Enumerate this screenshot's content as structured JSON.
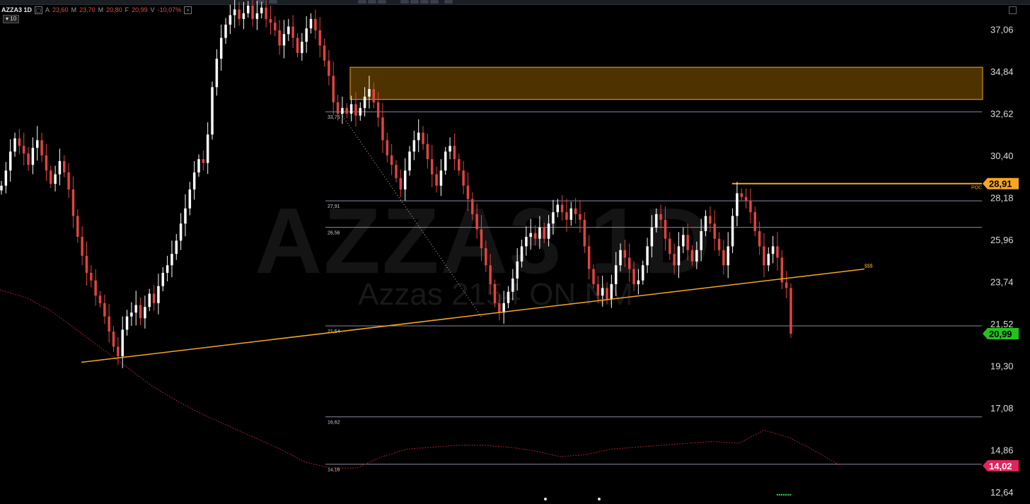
{
  "header": {
    "symbol": "AZZA3 1D",
    "open_label": "A",
    "open_value": "23,60",
    "high_label": "M",
    "high_value": "23,70",
    "low_label": "M",
    "low_value": "20,80",
    "close_label": "F",
    "close_value": "20,99",
    "change_label": "V",
    "change_value": "-10,07%",
    "collapse_label": "▾ 10"
  },
  "watermark": {
    "symbol": "AZZA3 1D",
    "company": "Azzas 2154 ON NM"
  },
  "colors": {
    "background": "#000000",
    "candle_up": "#ffffff",
    "candle_down": "#e0443e",
    "zone_fill": "#4d3300",
    "zone_border": "#f5a623",
    "trendline": "#f5a623",
    "current_price_bg": "#22c41c",
    "ma_badge_bg": "#e0245e",
    "level_line": "#8a8aa0",
    "moving_average": "#b0202a"
  },
  "chart_data": {
    "type": "candlestick",
    "symbol": "AZZA3",
    "timeframe": "1D",
    "ylim": [
      12.0,
      38.6
    ],
    "y_ticks": [
      "37,06",
      "34,84",
      "32,62",
      "30,40",
      "28,18",
      "25,96",
      "23,74",
      "21,52",
      "19,30",
      "17,08",
      "14,86",
      "12,64"
    ],
    "current_price": "20,99",
    "poc_price": "28,91",
    "poc_label": "POC",
    "ma_value": "14,02",
    "trend_label": "$$$",
    "levels": [
      {
        "label": "33,76",
        "value": 32.7
      },
      {
        "label": "27,91",
        "value": 28.0
      },
      {
        "label": "26,56",
        "value": 26.6
      },
      {
        "label": "21,54",
        "value": 21.4
      },
      {
        "label": "16,62",
        "value": 16.6
      },
      {
        "label": "14,16",
        "value": 14.1
      }
    ],
    "resistance_zone": {
      "low": 33.35,
      "high": 35.05
    },
    "trendline": {
      "start": {
        "x": 115,
        "value": 19.48
      },
      "end": {
        "x": 1222,
        "value": 24.4
      }
    },
    "dotted_line": {
      "start": {
        "x": 482,
        "value": 32.6
      },
      "end": {
        "x": 682,
        "value": 21.8
      }
    },
    "closes": [
      28.8,
      29.6,
      30.6,
      31.3,
      30.9,
      30.5,
      29.9,
      30.8,
      31.2,
      30.4,
      29.6,
      28.9,
      29.4,
      30.1,
      29.5,
      28.6,
      27.2,
      26.1,
      25.1,
      24.2,
      23.8,
      23.0,
      22.6,
      21.9,
      21.1,
      20.3,
      19.8,
      21.2,
      21.9,
      22.1,
      22.5,
      21.8,
      22.4,
      23.1,
      22.6,
      23.5,
      24.2,
      24.6,
      25.2,
      25.9,
      26.8,
      27.6,
      28.6,
      29.5,
      30.2,
      30.0,
      31.5,
      34.0,
      35.5,
      36.6,
      37.3,
      37.8,
      38.1,
      37.6,
      37.9,
      38.3,
      37.6,
      37.9,
      38.2,
      37.6,
      37.4,
      37.0,
      36.2,
      36.8,
      37.2,
      36.6,
      35.8,
      36.4,
      37.1,
      37.6,
      37.0,
      36.2,
      35.4,
      34.6,
      33.2,
      32.6,
      32.9,
      32.6,
      33.1,
      32.5,
      32.9,
      33.5,
      33.9,
      33.2,
      32.4,
      31.2,
      30.4,
      29.9,
      29.2,
      28.6,
      29.6,
      30.6,
      31.2,
      31.6,
      31.0,
      30.2,
      29.4,
      28.8,
      29.6,
      30.6,
      30.9,
      30.2,
      29.6,
      28.8,
      28.1,
      27.3,
      26.5,
      25.5,
      24.6,
      23.6,
      22.6,
      22.1,
      22.6,
      23.2,
      23.9,
      24.8,
      25.6,
      26.1,
      26.3,
      26.0,
      26.6,
      26.0,
      26.8,
      27.4,
      27.8,
      27.4,
      27.0,
      27.6,
      27.3,
      27.0,
      25.6,
      24.4,
      23.6,
      23.0,
      23.4,
      22.8,
      23.6,
      24.6,
      25.4,
      25.0,
      24.4,
      23.6,
      23.8,
      24.6,
      25.6,
      26.6,
      27.3,
      27.0,
      26.0,
      25.2,
      24.6,
      25.6,
      26.2,
      25.4,
      24.8,
      25.4,
      26.4,
      27.2,
      26.8,
      26.0,
      25.4,
      24.6,
      25.6,
      27.2,
      28.4,
      28.2,
      28.0,
      27.4,
      26.4,
      25.6,
      24.6,
      25.2,
      25.6,
      25.0,
      23.7,
      23.4,
      20.99
    ],
    "ma_series": [
      23.3,
      22.9,
      22.2,
      21.2,
      20.2,
      19.2,
      18.2,
      17.4,
      16.7,
      16.1,
      15.5,
      14.9,
      14.2,
      13.9,
      13.9,
      14.5,
      14.9,
      15.0,
      15.1,
      15.1,
      15.0,
      14.8,
      14.5,
      14.6,
      14.9,
      15.0,
      15.1,
      15.2,
      15.3,
      15.2,
      15.9,
      15.5,
      14.8,
      14.02
    ],
    "ma_step_x": 36
  }
}
